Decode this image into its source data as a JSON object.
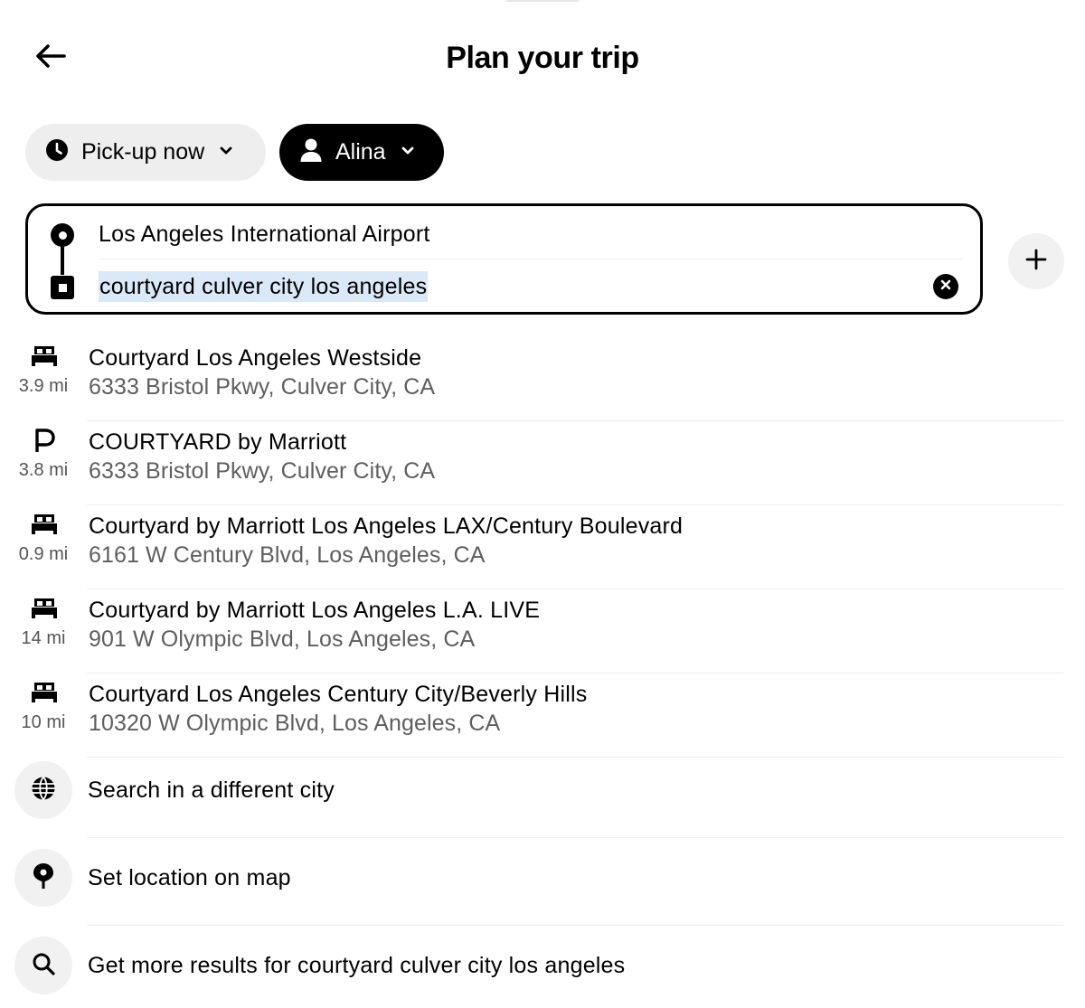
{
  "header": {
    "title": "Plan your trip",
    "back_icon": "arrow-left-icon"
  },
  "chips": {
    "pickup": {
      "label": "Pick-up now",
      "icon": "clock-icon"
    },
    "rider": {
      "label": "Alina",
      "icon": "person-icon"
    }
  },
  "route": {
    "origin": "Los Angeles International Airport",
    "destination_value": "courtyard culver city los angeles"
  },
  "results": [
    {
      "icon": "hotel-bed-icon",
      "distance": "3.9 mi",
      "name": "Courtyard Los Angeles Westside",
      "address": "6333 Bristol Pkwy, Culver City, CA"
    },
    {
      "icon": "parking-icon",
      "distance": "3.8 mi",
      "name": "COURTYARD by Marriott",
      "address": "6333 Bristol Pkwy, Culver City, CA"
    },
    {
      "icon": "hotel-bed-icon",
      "distance": "0.9 mi",
      "name": "Courtyard by Marriott Los Angeles LAX/Century Boulevard",
      "address": "6161 W Century Blvd, Los Angeles, CA"
    },
    {
      "icon": "hotel-bed-icon",
      "distance": "14 mi",
      "name": "Courtyard by Marriott Los Angeles L.A. LIVE",
      "address": "901 W Olympic Blvd, Los Angeles, CA"
    },
    {
      "icon": "hotel-bed-icon",
      "distance": "10 mi",
      "name": "Courtyard Los Angeles Century City/Beverly Hills",
      "address": "10320 W Olympic Blvd, Los Angeles, CA"
    }
  ],
  "actions": [
    {
      "icon": "globe-icon",
      "label": "Search in a different city"
    },
    {
      "icon": "map-pin-icon",
      "label": "Set location on map"
    },
    {
      "icon": "search-icon",
      "label": "Get more results for courtyard culver city los angeles"
    }
  ],
  "colors": {
    "chip_inactive_bg": "#eeeeee",
    "chip_active_bg": "#000000",
    "selection_highlight": "#dbe8f7",
    "secondary_text": "#5e5e5e"
  }
}
